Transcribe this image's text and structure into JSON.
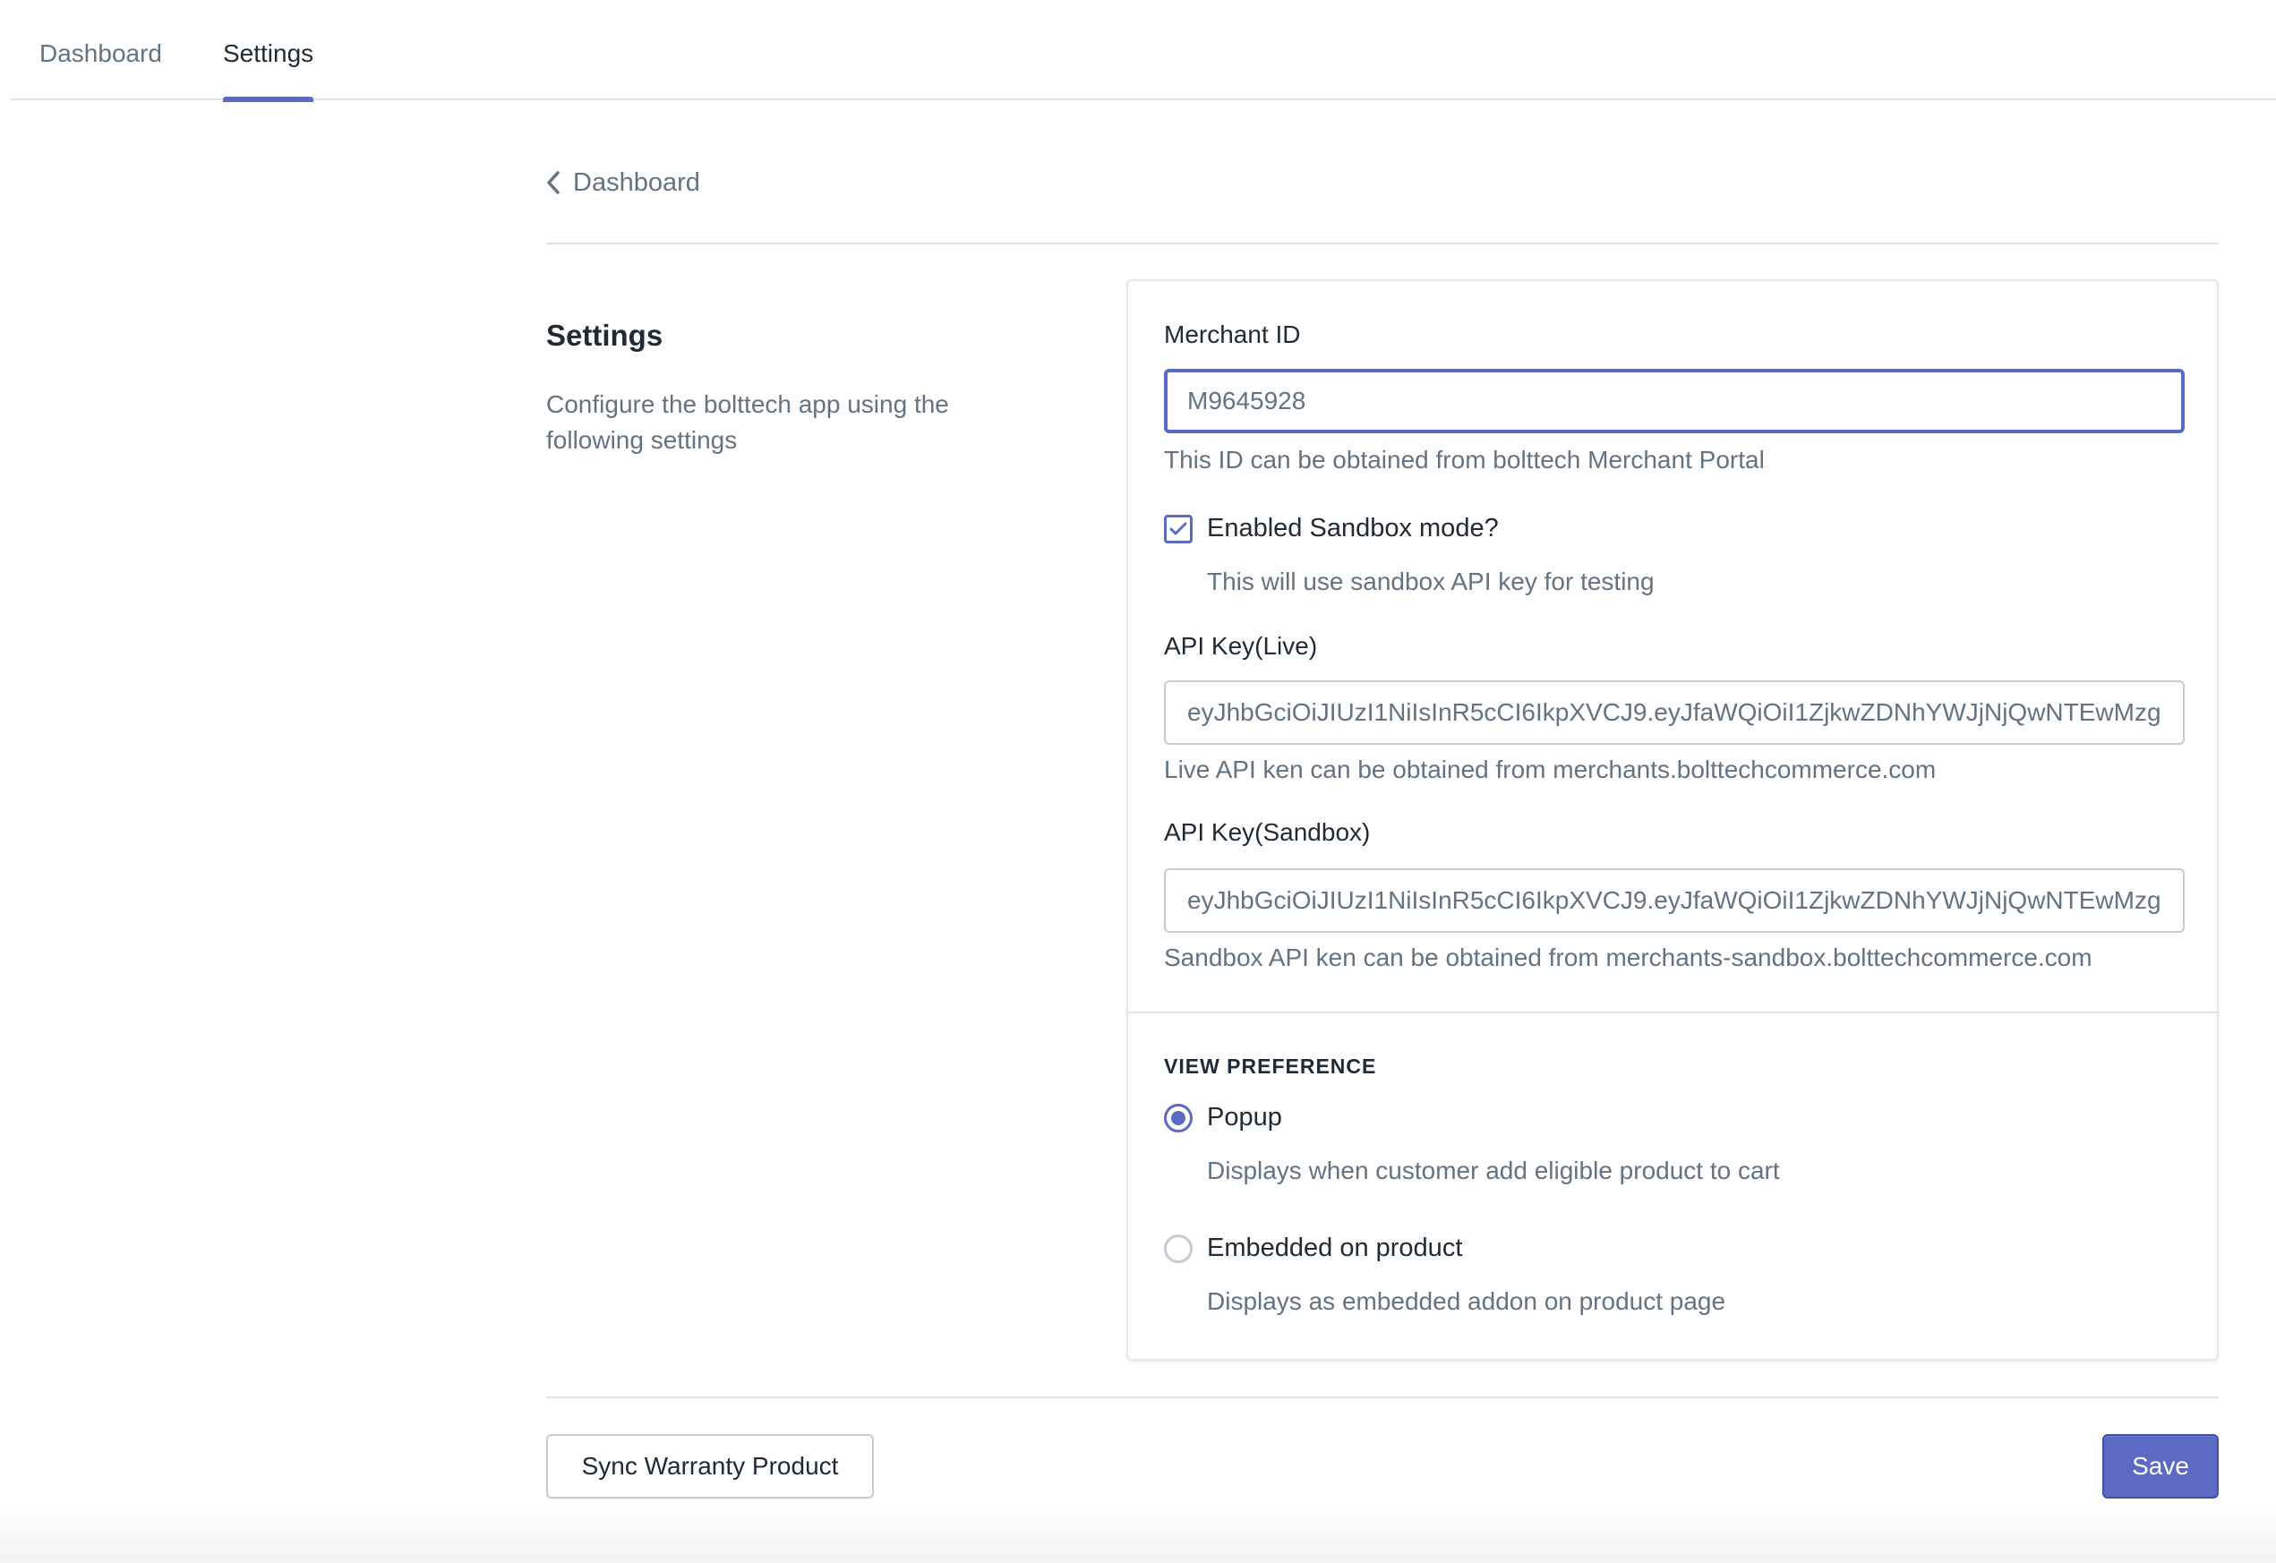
{
  "tabs": [
    {
      "label": "Dashboard",
      "active": false
    },
    {
      "label": "Settings",
      "active": true
    }
  ],
  "breadcrumb": {
    "label": "Dashboard",
    "icon": "chevron-left-icon"
  },
  "section": {
    "title": "Settings",
    "description": "Configure the bolttech app using the following settings"
  },
  "form": {
    "merchant_id": {
      "label": "Merchant ID",
      "value": "M9645928",
      "help": "This ID can be obtained from bolttech Merchant Portal"
    },
    "sandbox": {
      "label": "Enabled Sandbox mode?",
      "checked": true,
      "help": "This will use sandbox API key for testing"
    },
    "api_key_live": {
      "label": "API Key(Live)",
      "value": "eyJhbGciOiJIUzI1NiIsInR5cCI6IkpXVCJ9.eyJfaWQiOiI1ZjkwZDNhYWJjNjQwNTEwMzg",
      "help": "Live API ken can be obtained from merchants.bolttechcommerce.com"
    },
    "api_key_sandbox": {
      "label": "API Key(Sandbox)",
      "value": "eyJhbGciOiJIUzI1NiIsInR5cCI6IkpXVCJ9.eyJfaWQiOiI1ZjkwZDNhYWJjNjQwNTEwMzg",
      "help": "Sandbox API ken can be obtained from merchants-sandbox.bolttechcommerce.com"
    }
  },
  "view_preference": {
    "heading": "VIEW PREFERENCE",
    "options": [
      {
        "label": "Popup",
        "help": "Displays when customer add eligible product to cart",
        "selected": true
      },
      {
        "label": "Embedded on product",
        "help": "Displays as embedded addon on product page",
        "selected": false
      }
    ]
  },
  "actions": {
    "sync_label": "Sync Warranty Product",
    "save_label": "Save"
  },
  "colors": {
    "accent": "#5c6ac4",
    "text": "#212b36",
    "subdued": "#637381",
    "border": "#c4cdd5"
  }
}
